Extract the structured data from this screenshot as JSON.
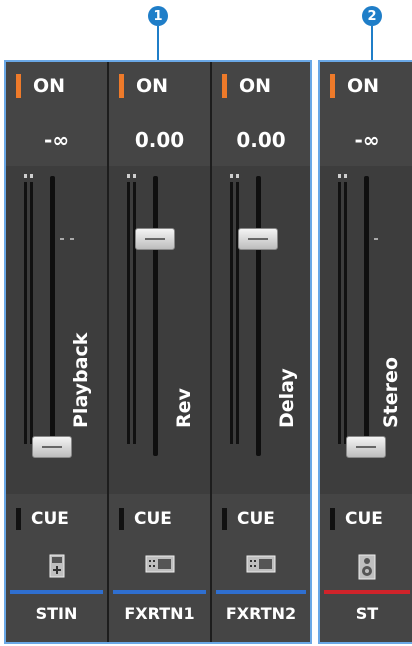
{
  "callouts": [
    "1",
    "2"
  ],
  "channels": [
    {
      "on_label": "ON",
      "gain": "-∞",
      "label": "Playback",
      "cue_label": "CUE",
      "icon": "stin-icon",
      "name": "STIN",
      "color": "#2f6fd0",
      "fader_level": 0.0
    },
    {
      "on_label": "ON",
      "gain": "0.00",
      "label": "Rev",
      "cue_label": "CUE",
      "icon": "fx-return-icon",
      "name": "FXRTN1",
      "color": "#2f6fd0",
      "fader_level": 0.8
    },
    {
      "on_label": "ON",
      "gain": "0.00",
      "label": "Delay",
      "cue_label": "CUE",
      "icon": "fx-return-icon",
      "name": "FXRTN2",
      "color": "#2f6fd0",
      "fader_level": 0.8
    },
    {
      "on_label": "ON",
      "gain": "-∞",
      "label": "Stereo",
      "cue_label": "CUE",
      "icon": "speaker-icon",
      "name": "ST",
      "color": "#d0232a",
      "fader_level": 0.0
    }
  ],
  "colors": {
    "on_indicator": "#ee7a2a",
    "callout": "#1f7ec8",
    "group_border": "#6aa8e6"
  }
}
